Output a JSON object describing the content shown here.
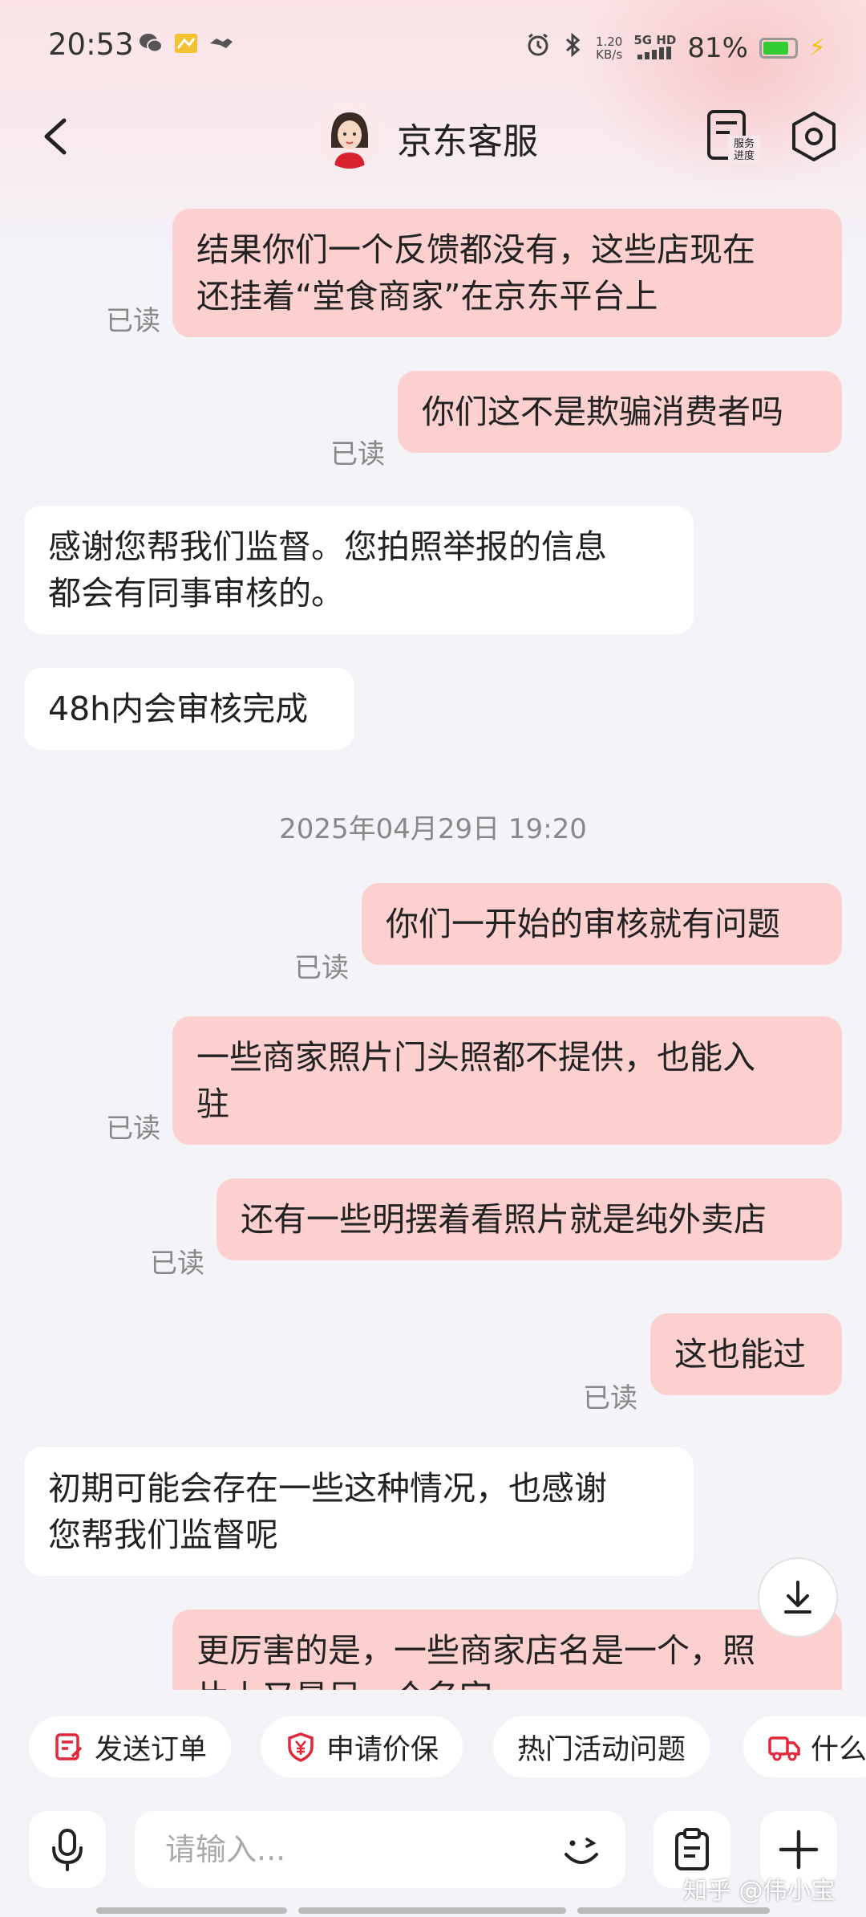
{
  "status_bar": {
    "time": "20:53",
    "net_speed_value": "1.20",
    "net_speed_unit": "KB/s",
    "signal_label": "5G HD",
    "battery_percent": "81%",
    "battery_level": 0.81,
    "battery_color": "#33cc33"
  },
  "header": {
    "title": "京东客服",
    "service_progress_label_line1": "服务",
    "service_progress_label_line2": "进度"
  },
  "messages": [
    {
      "dir": "out",
      "lines": [
        "结果你们一个反馈都没有，这些店现在",
        "还挂着“堂食商家”在京东平台上"
      ],
      "read": "已读"
    },
    {
      "dir": "out",
      "lines": [
        "你们这不是欺骗消费者吗"
      ],
      "read": "已读"
    },
    {
      "dir": "in",
      "lines": [
        "感谢您帮我们监督。您拍照举报的信息",
        "都会有同事审核的。"
      ]
    },
    {
      "dir": "in",
      "lines": [
        "48h内会审核完成"
      ]
    },
    {
      "timestamp": "2025年04月29日 19:20"
    },
    {
      "dir": "out",
      "lines": [
        "你们一开始的审核就有问题"
      ],
      "read": "已读"
    },
    {
      "dir": "out",
      "lines": [
        "一些商家照片门头照都不提供，也能入",
        "驻"
      ],
      "read": "已读"
    },
    {
      "dir": "out",
      "lines": [
        "还有一些明摆着看照片就是纯外卖店"
      ],
      "read": "已读"
    },
    {
      "dir": "out",
      "lines": [
        "这也能过"
      ],
      "read": "已读"
    },
    {
      "dir": "in",
      "lines": [
        "初期可能会存在一些这种情况，也感谢",
        "您帮我们监督呢"
      ]
    },
    {
      "dir": "out",
      "lines": [
        "更厉害的是，一些商家店名是一个，照",
        "片上又是另一个名字"
      ]
    }
  ],
  "quick_actions": [
    "发送订单",
    "申请价保",
    "热门活动问题",
    "什么"
  ],
  "input": {
    "placeholder": "请输入..."
  },
  "watermark": "知乎 @伟小宝",
  "colors": {
    "outgoing_bubble": "#fdd0d0",
    "incoming_bubble": "#ffffff",
    "accent": "#e0283c"
  }
}
